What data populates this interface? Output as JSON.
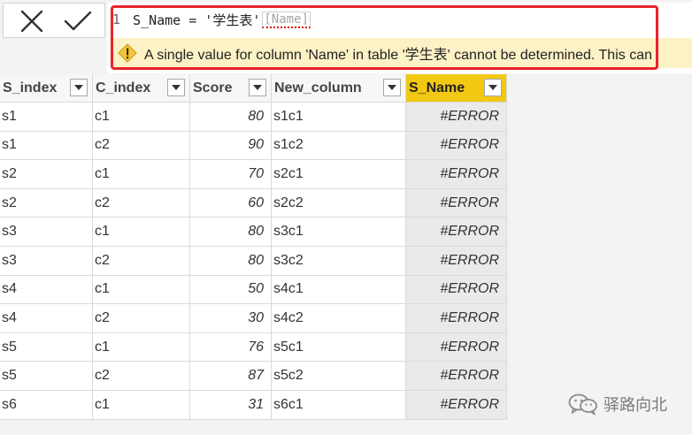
{
  "formula_bar": {
    "cancel_icon": "close-icon",
    "commit_icon": "checkmark-icon",
    "line_number": "1",
    "formula_text": "S_Name = '学生表'",
    "formula_ref": "[Name]",
    "warning_icon": "warning-icon",
    "warning_text": "A single value for column 'Name' in table '学生表' cannot be determined. This can",
    "highlight_color": "#e8232c",
    "warning_bg": "#fdf1c6"
  },
  "grid": {
    "columns": [
      {
        "label": "S_index",
        "active": false
      },
      {
        "label": "C_index",
        "active": false
      },
      {
        "label": "Score",
        "active": false
      },
      {
        "label": "New_column",
        "active": false
      },
      {
        "label": "S_Name",
        "active": true
      }
    ],
    "active_column_color": "#f2c811",
    "filter_icon": "chevron-down-icon",
    "rows": [
      {
        "s_index": "s1",
        "c_index": "c1",
        "score": "80",
        "new_column": "s1c1",
        "s_name": "#ERROR"
      },
      {
        "s_index": "s1",
        "c_index": "c2",
        "score": "90",
        "new_column": "s1c2",
        "s_name": "#ERROR"
      },
      {
        "s_index": "s2",
        "c_index": "c1",
        "score": "70",
        "new_column": "s2c1",
        "s_name": "#ERROR"
      },
      {
        "s_index": "s2",
        "c_index": "c2",
        "score": "60",
        "new_column": "s2c2",
        "s_name": "#ERROR"
      },
      {
        "s_index": "s3",
        "c_index": "c1",
        "score": "80",
        "new_column": "s3c1",
        "s_name": "#ERROR"
      },
      {
        "s_index": "s3",
        "c_index": "c2",
        "score": "80",
        "new_column": "s3c2",
        "s_name": "#ERROR"
      },
      {
        "s_index": "s4",
        "c_index": "c1",
        "score": "50",
        "new_column": "s4c1",
        "s_name": "#ERROR"
      },
      {
        "s_index": "s4",
        "c_index": "c2",
        "score": "30",
        "new_column": "s4c2",
        "s_name": "#ERROR"
      },
      {
        "s_index": "s5",
        "c_index": "c1",
        "score": "76",
        "new_column": "s5c1",
        "s_name": "#ERROR"
      },
      {
        "s_index": "s5",
        "c_index": "c2",
        "score": "87",
        "new_column": "s5c2",
        "s_name": "#ERROR"
      },
      {
        "s_index": "s6",
        "c_index": "c1",
        "score": "31",
        "new_column": "s6c1",
        "s_name": "#ERROR"
      }
    ]
  },
  "watermark": {
    "icon": "wechat-icon",
    "text": "驿路向北"
  }
}
